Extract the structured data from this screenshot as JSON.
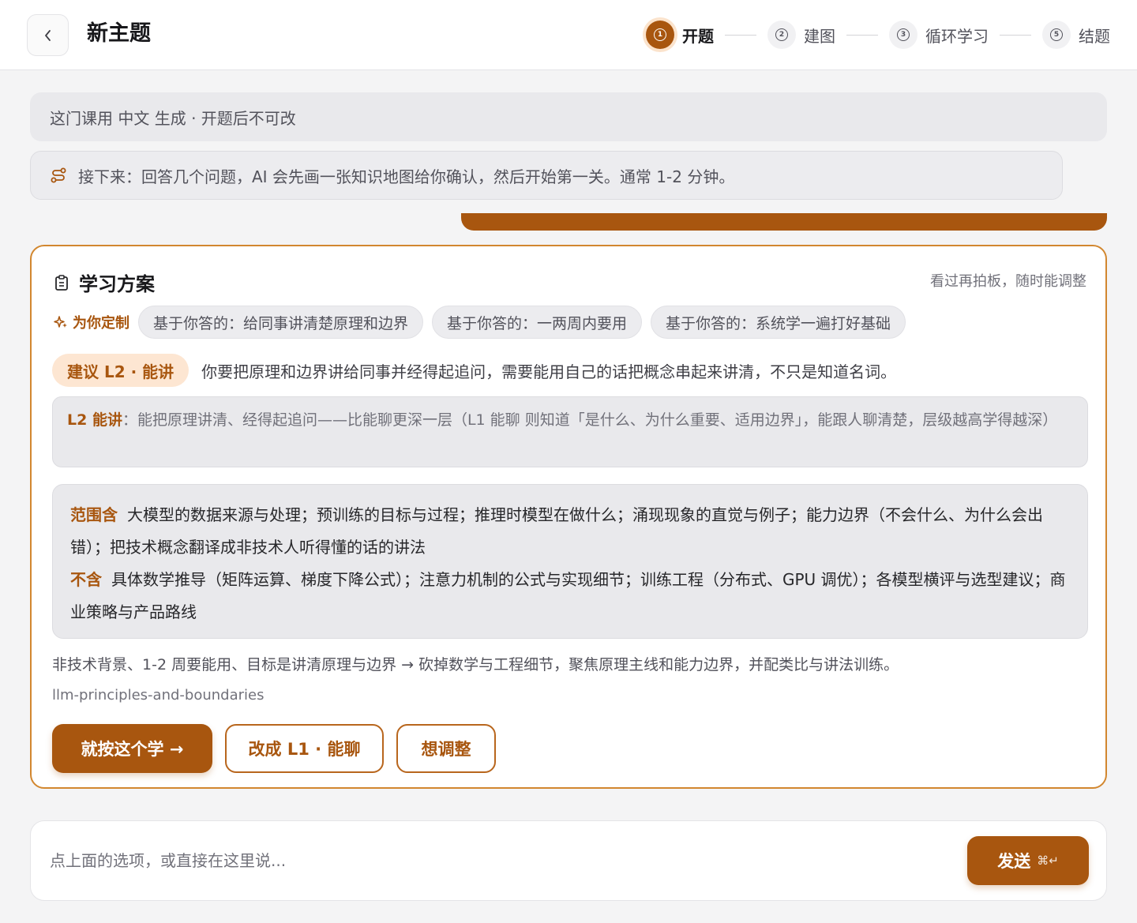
{
  "header": {
    "back_icon": "chevron-left-icon",
    "title": "新主题",
    "steps": [
      {
        "num": "1",
        "label": "开题",
        "active": true
      },
      {
        "num": "2",
        "label": "建图",
        "active": false
      },
      {
        "num": "3",
        "label": "循环学习",
        "active": false
      },
      {
        "num": "5",
        "label": "结题",
        "active": false
      }
    ]
  },
  "info_bar": {
    "text": "这门课用 中文 生成 · 开题后不可改"
  },
  "next_bar": {
    "icon": "route-icon",
    "text": "接下来：回答几个问题，AI 会先画一张知识地图给你确认，然后开始第一关。通常 1-2 分钟。"
  },
  "plan": {
    "title": "学习方案",
    "hint": "看过再拍板，随时能调整",
    "custom_label": "为你定制",
    "chips": [
      "基于你答的：给同事讲清楚原理和边界",
      "基于你答的：一两周内要用",
      "基于你答的：系统学一遍打好基础"
    ],
    "suggest_badge": "建议 L2 · 能讲",
    "suggest_text": "你要把原理和边界讲给同事并经得起追问，需要能用自己的话把概念串起来讲清，不只是知道名词。",
    "level_name": "L2 能讲",
    "level_desc": "：能把原理讲清、经得起追问——比能聊更深一层（L1 能聊 则知道「是什么、为什么重要、适用边界」，能跟人聊清楚，层级越高学得越深）",
    "scope_in_label": "范围含",
    "scope_in": "大模型的数据来源与处理；预训练的目标与过程；推理时模型在做什么；涌现现象的直觉与例子；能力边界（不会什么、为什么会出错）；把技术概念翻译成非技术人听得懂的话的讲法",
    "scope_out_label": "不含",
    "scope_out": "具体数学推导（矩阵运算、梯度下降公式）；注意力机制的公式与实现细节；训练工程（分布式、GPU 调优）；各模型横评与选型建议；商业策略与产品路线",
    "reason": "非技术背景、1-2 周要能用、目标是讲清原理与边界 → 砍掉数学与工程细节，聚焦原理主线和能力边界，并配类比与讲法训练。",
    "slug": "llm-principles-and-boundaries",
    "btn_accept": "就按这个学 →",
    "btn_l1": "改成 L1 · 能聊",
    "btn_adjust": "想调整"
  },
  "composer": {
    "placeholder": "点上面的选项，或直接在这里说...",
    "send_label": "发送",
    "send_shortcut": "⌘↵"
  },
  "colors": {
    "accent": "#a8560f",
    "accent_light": "#fde6d2",
    "border_accent": "#d2872f"
  }
}
